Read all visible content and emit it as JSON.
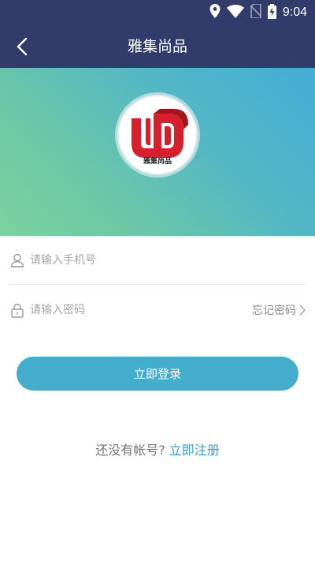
{
  "status_bar": {
    "time": "9:04",
    "icons": [
      "location-icon",
      "wifi-icon",
      "no-sim-icon",
      "battery-charging-icon"
    ]
  },
  "app_bar": {
    "title": "雅集尚品",
    "back_icon": "chevron-left-icon"
  },
  "logo": {
    "caption": "雅集尚品",
    "brand_color": "#d8202c"
  },
  "form": {
    "phone": {
      "placeholder": "请输入手机号",
      "value": "",
      "icon": "user-icon"
    },
    "password": {
      "placeholder": "请输入密码",
      "value": "",
      "icon": "lock-icon"
    },
    "forgot_label": "忘记密码"
  },
  "login_button": {
    "label": "立即登录",
    "color": "#44adcc"
  },
  "register": {
    "prompt": "还没有帐号?",
    "link": "立即注册"
  },
  "colors": {
    "header": "#323c6a",
    "accent": "#44adcc"
  }
}
